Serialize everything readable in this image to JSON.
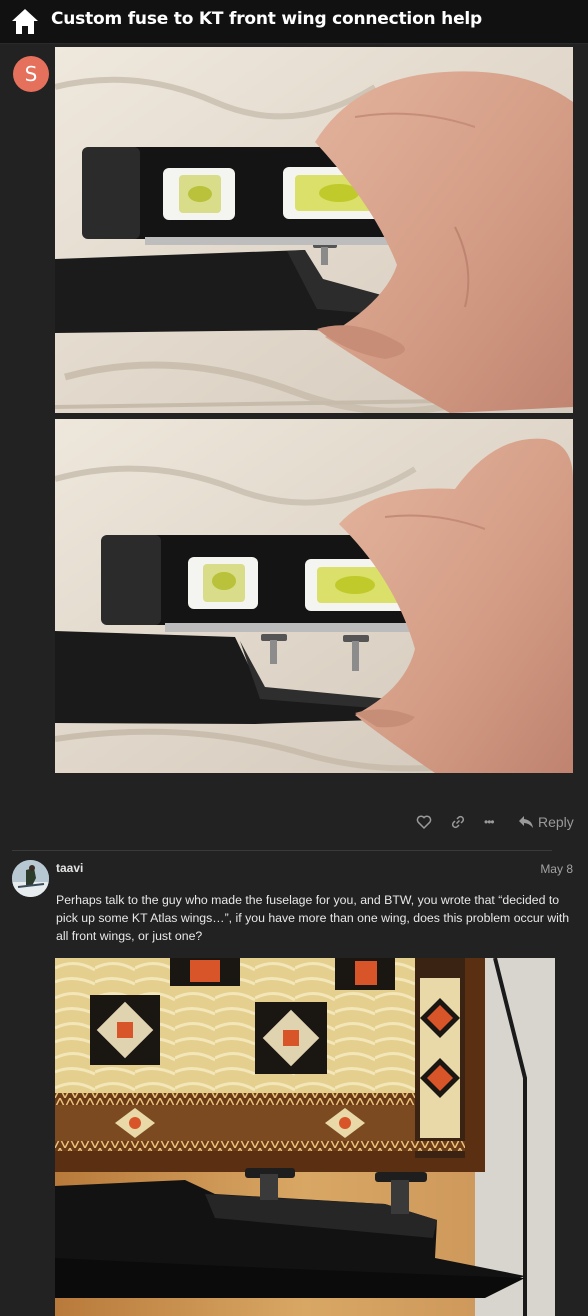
{
  "header": {
    "title": "Custom fuse to KT front wing connection help",
    "home_icon": "home-icon"
  },
  "first_post": {
    "author_initial": "S",
    "avatar_color": "#e5705b",
    "images": [
      "photo-level-on-fuselage-1",
      "photo-level-on-fuselage-2"
    ],
    "actions": {
      "like_icon": "heart-icon",
      "link_icon": "link-icon",
      "more_label": "•••",
      "reply_label": "Reply"
    }
  },
  "second_post": {
    "username": "taavi",
    "date": "May 8",
    "body": "Perhaps talk to the guy who made the fuselage for you, and BTW, you wrote that “decided to pick up some KT Atlas wings…”, if you have more than one wing, does this problem occur with all front wings, or just one?",
    "images": [
      "photo-mast-on-inlaid-box"
    ]
  },
  "colors": {
    "background": "#222222",
    "header_bg": "#111111",
    "text": "#e8e8e8",
    "muted": "#9a9a9a"
  }
}
